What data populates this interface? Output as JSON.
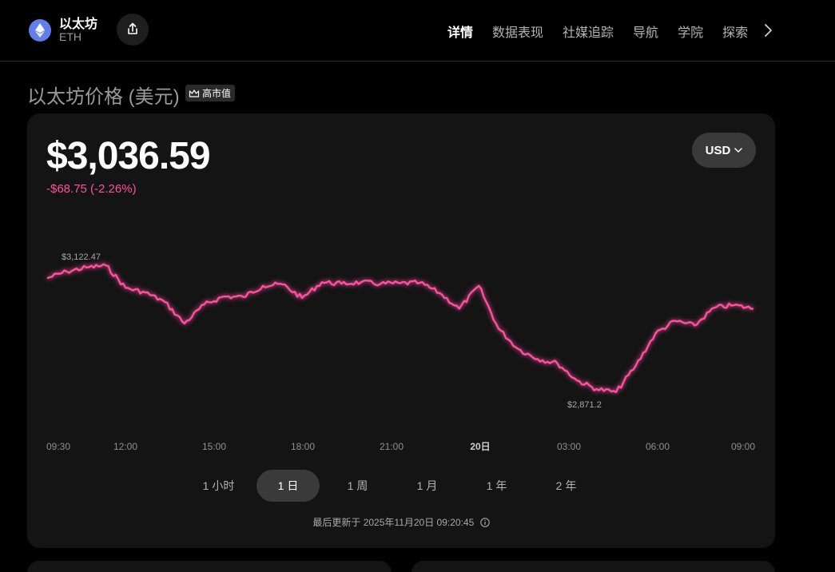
{
  "header": {
    "coin_name": "以太坊",
    "coin_symbol": "ETH",
    "nav": [
      "详情",
      "数据表现",
      "社媒追踪",
      "导航",
      "学院",
      "探索"
    ],
    "active_nav": 0
  },
  "page": {
    "title": "以太坊价格 (美元)",
    "badge": "高市值"
  },
  "price_card": {
    "price": "$3,036.59",
    "change": "-$68.75 (-2.26%)",
    "currency": "USD",
    "ranges": [
      "1 小时",
      "1 日",
      "1 周",
      "1 月",
      "1 年",
      "2 年"
    ],
    "active_range": 1,
    "updated": "最后更新于 2025年11月20日 09:20:45"
  },
  "colors": {
    "accent": "#ff4fa0",
    "background": "#000000",
    "card": "#141414",
    "eth_blue": "#627eea"
  },
  "chart_data": {
    "type": "line",
    "x_tick_labels": [
      "09:30",
      "12:00",
      "15:00",
      "18:00",
      "21:00",
      "20日",
      "03:00",
      "06:00",
      "09:00"
    ],
    "bold_tick": "20日",
    "high_label": "$3,122.47",
    "low_label": "$2,871.2",
    "high": 3122.47,
    "low": 2871.2,
    "x_hours": [
      0,
      0.75,
      1.5,
      2.25,
      3,
      3.75,
      4.5,
      5.25,
      6,
      6.75,
      7.5,
      8.25,
      9,
      9.75,
      10.5,
      11.25,
      12,
      12.75,
      13.5,
      14.25,
      15,
      15.75,
      16.5,
      17.25,
      18,
      18.75,
      19.5,
      20.25,
      21,
      21.75,
      22.5,
      23.25,
      23.8
    ],
    "y": [
      3097,
      3110,
      3118,
      3122,
      3078,
      3069,
      3050,
      3008,
      3045,
      3061,
      3060,
      3082,
      3085,
      3058,
      3089,
      3086,
      3089,
      3086,
      3087,
      3088,
      3068,
      3037,
      3082,
      2998,
      2958,
      2938,
      2930,
      2896,
      2879,
      2873,
      2925,
      2988,
      3013,
      3004,
      3039,
      3044,
      3037
    ]
  }
}
